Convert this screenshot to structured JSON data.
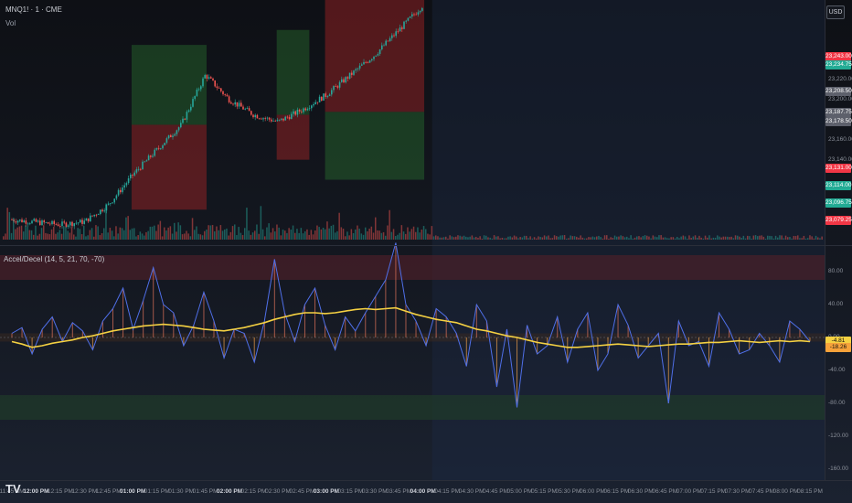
{
  "chart_header": {
    "symbol_title": "MNQ1! · 1 · CME",
    "volume_label": "Vol",
    "currency": "USD",
    "indicator_title": "Accel/Decel (14, 5, 21, 70, -70)"
  },
  "price_axis": {
    "labels": [
      "23,220.00",
      "23,200.00",
      "23,160.00",
      "23,140.00"
    ],
    "tags": [
      {
        "text": "23,243.00",
        "color": "#f23645",
        "price": 23243
      },
      {
        "text": "23,234.75",
        "color": "#22ab94",
        "price": 23234.75
      },
      {
        "text": "23,208.50",
        "color": "#5d606b",
        "price": 23208.5
      },
      {
        "text": "23,187.75",
        "color": "#5d606b",
        "price": 23187.75
      },
      {
        "text": "23,178.50",
        "color": "#5d606b",
        "price": 23178.5
      },
      {
        "text": "23,131.00",
        "color": "#f23645",
        "price": 23131
      },
      {
        "text": "23,114.00",
        "color": "#22ab94",
        "price": 23114
      },
      {
        "text": "23,096.75",
        "color": "#22ab94",
        "price": 23096.75
      },
      {
        "text": "23,079.25",
        "color": "#f23645",
        "price": 23079.25
      }
    ]
  },
  "indicator_axis": {
    "labels": [
      "80.00",
      "40.00",
      "0.00",
      "-40.00",
      "-80.00",
      "-120.00",
      "-160.00"
    ],
    "tags": [
      {
        "text": "-4.81",
        "color": "#f5d142",
        "value": -4.81
      },
      {
        "text": "-18.26",
        "color": "#f7a23a",
        "value": -8.26
      }
    ],
    "upper_threshold": 70,
    "lower_threshold": -70
  },
  "time_axis": {
    "labels": [
      "11:45 AM",
      "12:00 PM",
      "12:15 PM",
      "12:30 PM",
      "12:45 PM",
      "01:00 PM",
      "01:15 PM",
      "01:30 PM",
      "01:45 PM",
      "02:00 PM",
      "02:15 PM",
      "02:30 PM",
      "02:45 PM",
      "03:00 PM",
      "03:15 PM",
      "03:30 PM",
      "03:45 PM",
      "04:00 PM",
      "04:15 PM",
      "04:30 PM",
      "04:45 PM",
      "05:00 PM",
      "05:15 PM",
      "05:30 PM",
      "06:00 PM",
      "06:15 PM",
      "06:30 PM",
      "06:45 PM",
      "07:00 PM",
      "07:15 PM",
      "07:30 PM",
      "07:45 PM",
      "08:00 PM",
      "08:15 PM"
    ],
    "bold_labels": [
      "12:00 PM",
      "01:00 PM",
      "02:00 PM",
      "03:00 PM",
      "04:00 PM"
    ]
  },
  "colors": {
    "up": "#26a69a",
    "down": "#ef5350",
    "oscillator": "#4f6fe8",
    "signal": "#f5d142"
  },
  "chart_data": [
    {
      "type": "candlestick",
      "title": "MNQ1! · 1 · CME",
      "ylim": [
        23060,
        23300
      ],
      "price_checkpoints": [
        {
          "time": "11:45 AM",
          "price": 23080
        },
        {
          "time": "12:15 PM",
          "price": 23075
        },
        {
          "time": "12:30 PM",
          "price": 23078
        },
        {
          "time": "12:45 PM",
          "price": 23095
        },
        {
          "time": "01:00 PM",
          "price": 23125
        },
        {
          "time": "01:30 PM",
          "price": 23175
        },
        {
          "time": "01:45 PM",
          "price": 23225
        },
        {
          "time": "02:00 PM",
          "price": 23200
        },
        {
          "time": "02:15 PM",
          "price": 23185
        },
        {
          "time": "02:30 PM",
          "price": 23178
        },
        {
          "time": "02:45 PM",
          "price": 23190
        },
        {
          "time": "03:00 PM",
          "price": 23205
        },
        {
          "time": "03:30 PM",
          "price": 23245
        },
        {
          "time": "03:45 PM",
          "price": 23270
        },
        {
          "time": "04:00 PM",
          "price": 23295
        }
      ],
      "positions": [
        {
          "side": "long",
          "entry": 23175,
          "target": 23255,
          "stop": 23090
        },
        {
          "side": "long",
          "entry": 23185,
          "target": 23270,
          "stop": 23140
        },
        {
          "side": "short",
          "entry": 23188,
          "target": 23120,
          "stop": 23300
        }
      ]
    },
    {
      "type": "line",
      "title": "Accel/Decel (14, 5, 21, 70, -70)",
      "ylim": [
        -170,
        110
      ],
      "series": [
        {
          "values": [
            5,
            12,
            -20,
            10,
            25,
            -5,
            18,
            8,
            -15,
            20,
            35,
            60,
            10,
            45,
            85,
            40,
            30,
            -10,
            15,
            55,
            20,
            -25,
            10,
            5,
            -30,
            20,
            95,
            30,
            -5,
            40,
            60,
            15,
            -15,
            25,
            8,
            30,
            50,
            70,
            115,
            40,
            20,
            -10,
            35,
            25,
            5,
            -35,
            40,
            20,
            -60,
            10,
            -85,
            15,
            -20,
            -10,
            25,
            -30,
            10,
            30,
            -40,
            -20,
            40,
            15,
            -25,
            -10,
            5,
            -80,
            20,
            -10,
            -5,
            -35,
            30,
            10,
            -20,
            -15,
            5,
            -10,
            -30,
            20,
            10,
            -5
          ]
        },
        {
          "values": [
            -5,
            -8,
            -12,
            -10,
            -7,
            -5,
            -3,
            0,
            2,
            5,
            8,
            10,
            12,
            14,
            15,
            16,
            15,
            14,
            12,
            10,
            9,
            8,
            10,
            12,
            15,
            18,
            22,
            25,
            28,
            30,
            30,
            29,
            30,
            32,
            34,
            35,
            34,
            35,
            36,
            32,
            28,
            25,
            22,
            20,
            18,
            14,
            10,
            8,
            5,
            2,
            0,
            -3,
            -6,
            -8,
            -10,
            -12,
            -12,
            -11,
            -10,
            -9,
            -8,
            -9,
            -10,
            -11,
            -10,
            -9,
            -8,
            -8,
            -7,
            -6,
            -6,
            -5,
            -4,
            -5,
            -6,
            -5,
            -4,
            -5,
            -4,
            -5
          ]
        }
      ]
    }
  ]
}
